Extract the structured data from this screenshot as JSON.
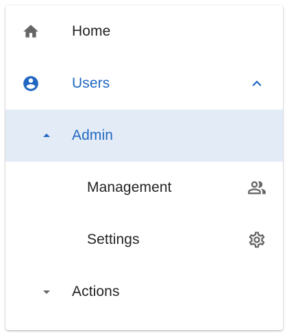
{
  "colors": {
    "accent": "#1f67c2",
    "selected_bg": "#e3ebf6",
    "text": "#222222",
    "icon_gray": "#666666"
  },
  "nav": {
    "items": [
      {
        "label": "Home",
        "icon": "home-icon"
      },
      {
        "label": "Users",
        "icon": "account-circle-icon",
        "trailing_icon": "chevron-up-icon",
        "expanded": true
      },
      {
        "label": "Admin",
        "icon": "arrow-up-icon",
        "selected": true,
        "expanded": true
      },
      {
        "label": "Management",
        "trailing_icon": "people-icon"
      },
      {
        "label": "Settings",
        "trailing_icon": "gear-icon"
      },
      {
        "label": "Actions",
        "icon": "arrow-down-icon",
        "expanded": false
      }
    ]
  }
}
